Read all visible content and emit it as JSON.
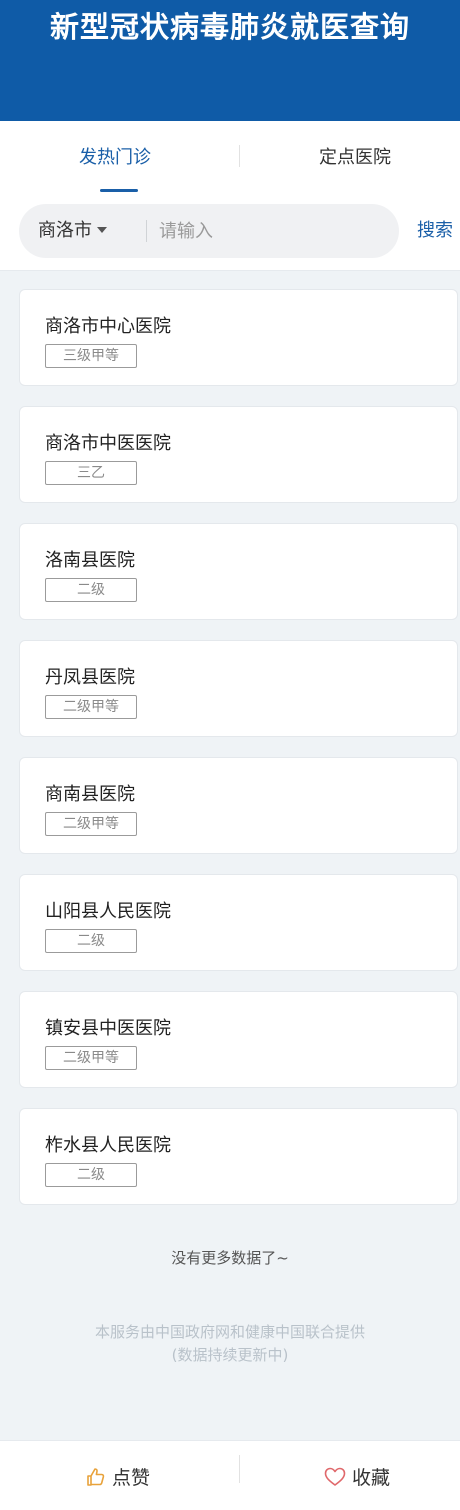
{
  "header": {
    "title": "新型冠状病毒肺炎就医查询"
  },
  "tabs": [
    {
      "label": "发热门诊",
      "active": true
    },
    {
      "label": "定点医院",
      "active": false
    }
  ],
  "search": {
    "city": "商洛市",
    "placeholder": "请输入",
    "button_label": "搜索"
  },
  "hospitals": [
    {
      "name": "商洛市中心医院",
      "level": "三级甲等"
    },
    {
      "name": "商洛市中医医院",
      "level": "三乙"
    },
    {
      "name": "洛南县医院",
      "level": "二级"
    },
    {
      "name": "丹凤县医院",
      "level": "二级甲等"
    },
    {
      "name": "商南县医院",
      "level": "二级甲等"
    },
    {
      "name": "山阳县人民医院",
      "level": "二级"
    },
    {
      "name": "镇安县中医医院",
      "level": "二级甲等"
    },
    {
      "name": "柞水县人民医院",
      "level": "二级"
    }
  ],
  "footer": {
    "no_more": "没有更多数据了~",
    "provider_line1": "本服务由中国政府网和健康中国联合提供",
    "provider_line2": "(数据持续更新中)"
  },
  "bottom_bar": {
    "like_label": "点赞",
    "favorite_label": "收藏",
    "like_icon": "thumbs-up-icon",
    "favorite_icon": "heart-icon"
  },
  "colors": {
    "header_bg": "#0f5ba7",
    "accent": "#1a5fa8",
    "page_bg": "#eff3f6"
  }
}
